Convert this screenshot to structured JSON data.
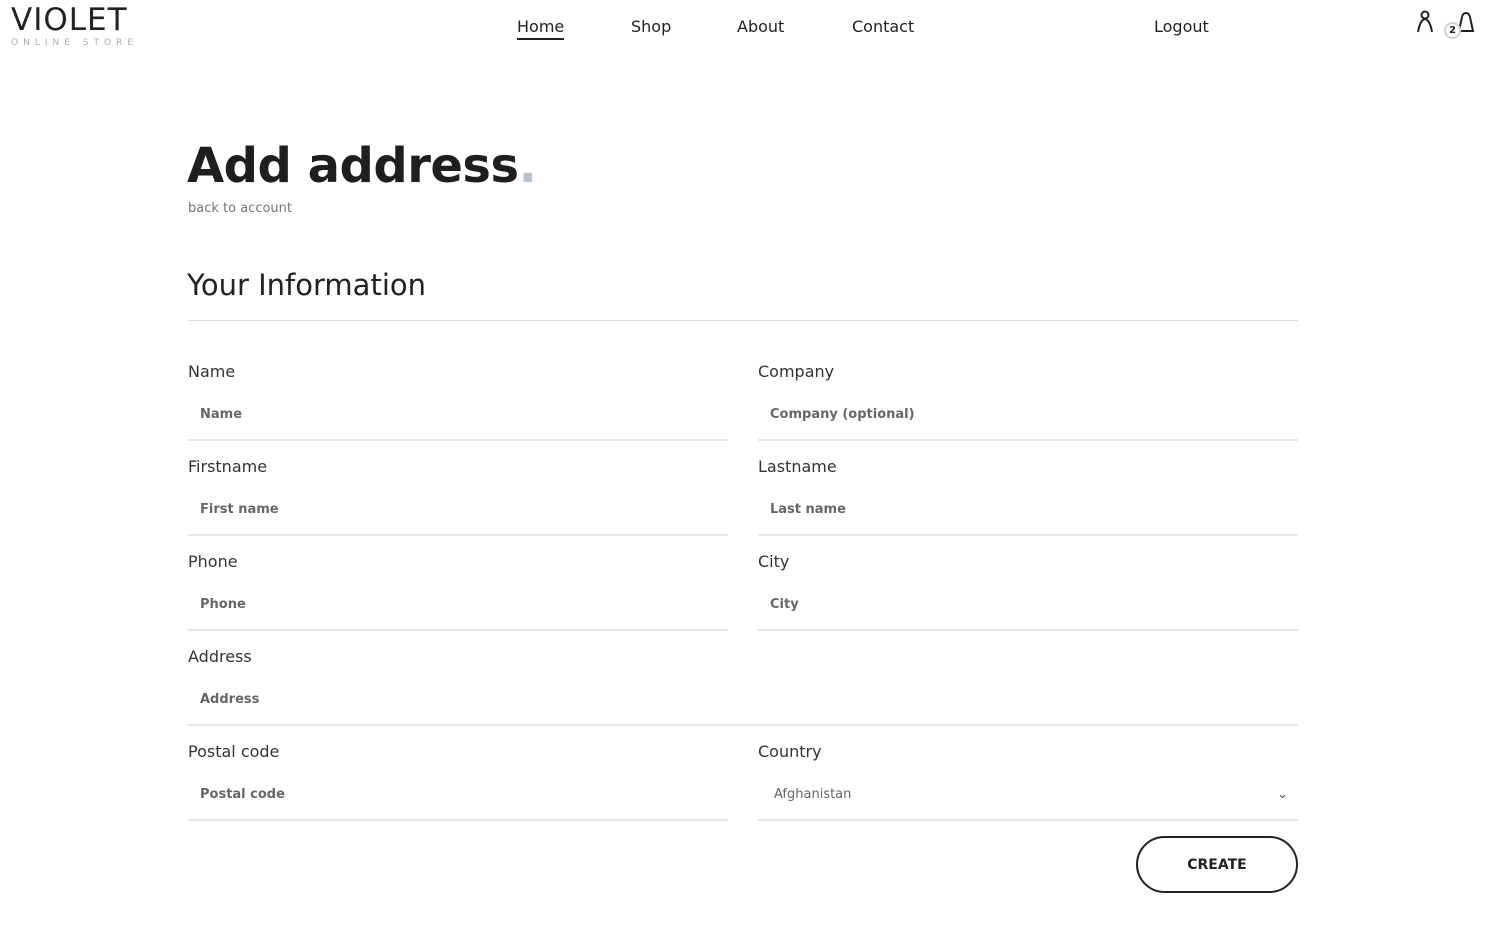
{
  "brand": {
    "name": "VIOLET",
    "tagline": "ONLINE STORE"
  },
  "nav": {
    "home": "Home",
    "shop": "Shop",
    "about": "About",
    "contact": "Contact",
    "logout": "Logout"
  },
  "cart": {
    "count": "2"
  },
  "page": {
    "title": "Add address",
    "title_dot": ".",
    "back": "back to account",
    "section": "Your Information"
  },
  "form": {
    "name": {
      "label": "Name",
      "placeholder": "Name"
    },
    "company": {
      "label": "Company",
      "placeholder": "Company (optional)"
    },
    "firstname": {
      "label": "Firstname",
      "placeholder": "First name"
    },
    "lastname": {
      "label": "Lastname",
      "placeholder": "Last name"
    },
    "phone": {
      "label": "Phone",
      "placeholder": "Phone"
    },
    "city": {
      "label": "City",
      "placeholder": "City"
    },
    "address": {
      "label": "Address",
      "placeholder": "Address"
    },
    "postal": {
      "label": "Postal code",
      "placeholder": "Postal code"
    },
    "country": {
      "label": "Country",
      "value": "Afghanistan"
    },
    "submit": "CREATE"
  }
}
